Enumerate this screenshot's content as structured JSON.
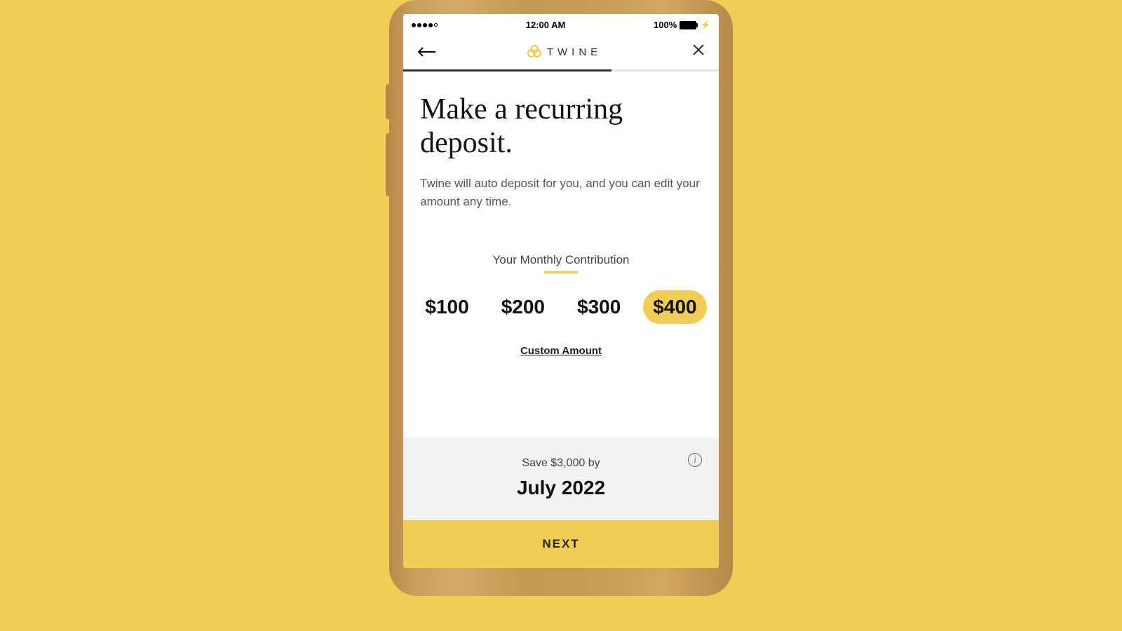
{
  "status": {
    "time": "12:00 AM",
    "battery": "100%"
  },
  "nav": {
    "brand": "TWINE"
  },
  "header": {
    "title": "Make a recurring deposit.",
    "subtitle": "Twine will auto deposit for you, and you can edit your amount any time."
  },
  "contribution": {
    "label": "Your Monthly Contribution",
    "options": [
      "$100",
      "$200",
      "$300",
      "$400"
    ],
    "selected_index": 3,
    "custom_label": "Custom Amount"
  },
  "summary": {
    "line1": "Save $3,000 by",
    "line2": "July 2022"
  },
  "cta": {
    "next": "NEXT"
  },
  "colors": {
    "accent": "#f0ce56"
  }
}
